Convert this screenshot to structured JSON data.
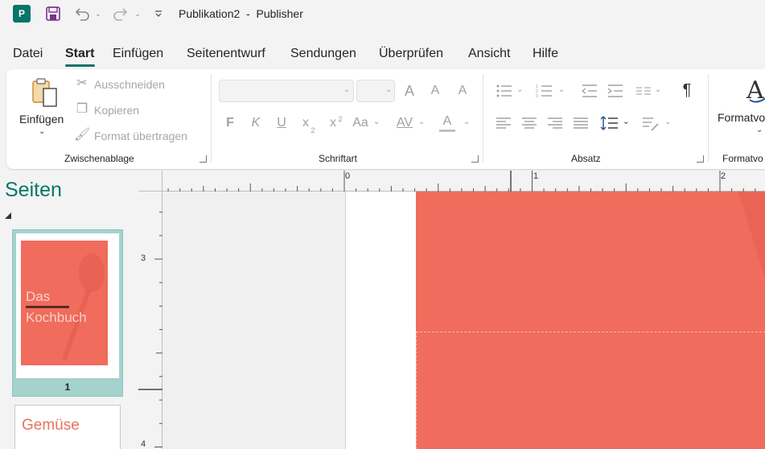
{
  "titlebar": {
    "app_letter": "P",
    "title": "Publikation2  -  Publisher"
  },
  "tabs": [
    {
      "label": "Datei"
    },
    {
      "label": "Start"
    },
    {
      "label": "Einfügen"
    },
    {
      "label": "Seitenentwurf"
    },
    {
      "label": "Sendungen"
    },
    {
      "label": "Überprüfen"
    },
    {
      "label": "Ansicht"
    },
    {
      "label": "Hilfe"
    }
  ],
  "active_tab": "Start",
  "ribbon": {
    "clipboard": {
      "paste_label": "Einfügen",
      "cut_label": "Ausschneiden",
      "copy_label": "Kopieren",
      "format_painter_label": "Format übertragen",
      "group_label": "Zwischenablage"
    },
    "font": {
      "bold": "F",
      "italic": "K",
      "underline": "U",
      "subscript": "x",
      "subscript_mark": "2",
      "superscript": "x",
      "superscript_mark": "2",
      "case": "Aa",
      "spacing": "AV",
      "grow": "A",
      "shrink": "A",
      "clear": "A",
      "color": "A",
      "group_label": "Schriftart"
    },
    "paragraph": {
      "pilcrow": "¶",
      "group_label": "Absatz"
    },
    "styles": {
      "label": "Formatvo",
      "group_label": "Formatvo"
    }
  },
  "pages_pane": {
    "title": "Seiten",
    "thumb1_title_line1": "Das",
    "thumb1_title_line2": "Kochbuch",
    "thumb1_page_number": "1",
    "thumb2_title": "Gemüse"
  },
  "ruler": {
    "h_labels": [
      "0",
      "1",
      "2"
    ],
    "v_labels": [
      "3",
      "4"
    ]
  },
  "colors": {
    "accent": "#077568",
    "cover": "#f06c5c",
    "thumb_selected": "#a4d2cd"
  },
  "icons": {
    "app": "publisher-logo-icon",
    "save": "save-icon",
    "undo": "undo-icon",
    "redo": "redo-icon",
    "customize": "customize-quick-access-icon"
  }
}
